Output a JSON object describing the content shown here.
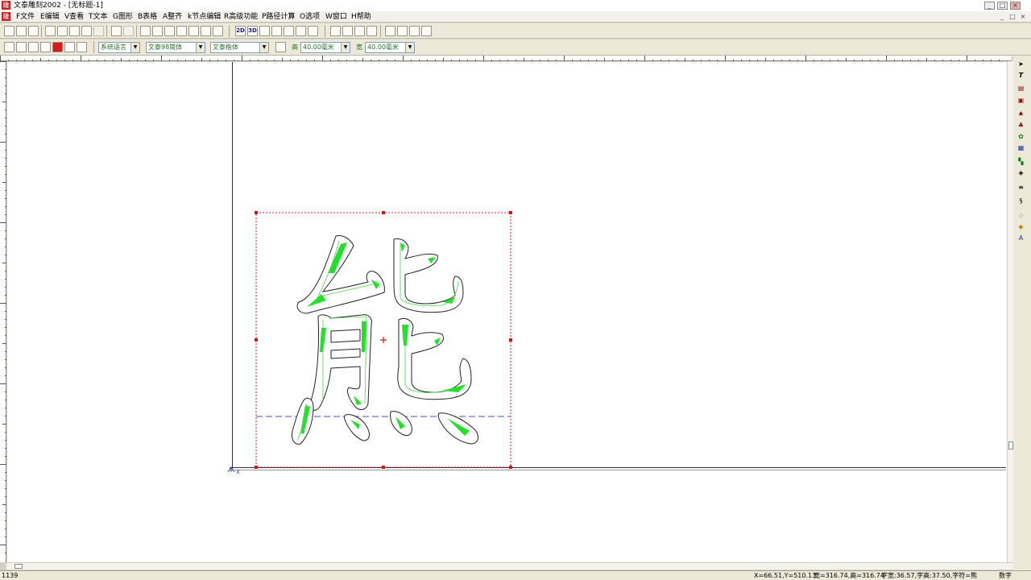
{
  "window": {
    "title": "文泰雕刻2002 - [无标题-1]",
    "app_icon_glyph": "雕",
    "controls": [
      "_",
      "□",
      "×"
    ],
    "mdi_controls": [
      "_",
      "□",
      "×"
    ]
  },
  "menu": [
    "F文件",
    "E编辑",
    "V查看",
    "T文本",
    "G图形",
    "B表格",
    "A整齐",
    "k节点编辑",
    "R高级功能",
    "P路径计算",
    "O选项",
    "W窗口",
    "H帮助"
  ],
  "toolbar": {
    "text_buttons": [
      "2D",
      "3D"
    ]
  },
  "format_bar": {
    "language": "系统语言",
    "font1": "文泰98简体",
    "font2": "文泰楷体",
    "height_label": "高",
    "height_value": "40.00毫米",
    "width_label": "宽",
    "width_value": "40.00毫米"
  },
  "canvas": {
    "character": "熊",
    "origin_label": "x",
    "selection_color": "#d01818",
    "stroke_fill_color": "#22e02a",
    "baseline_color": "#6f6fd8"
  },
  "status": {
    "left": "1139",
    "coords": "X=66.51,Y=510.13",
    "size": "宽=316.74,高=316.74",
    "char_info": "字宽:36.57,字高:37.50,字符=熊",
    "mode": "数字"
  }
}
